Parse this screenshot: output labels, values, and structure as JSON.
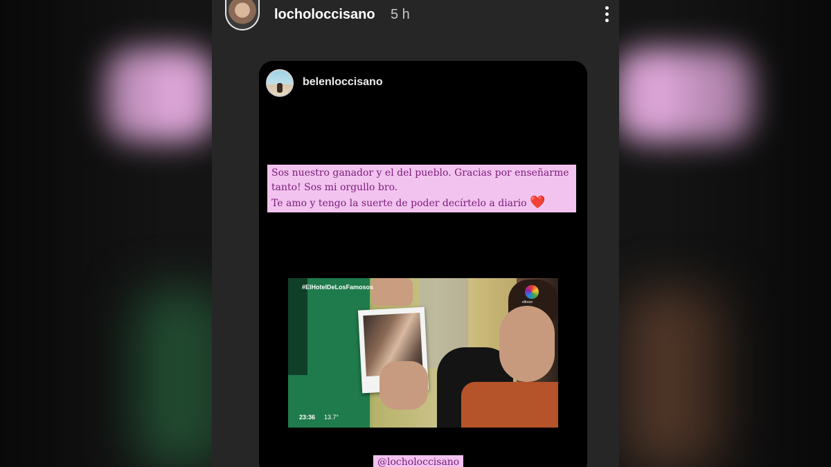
{
  "story": {
    "username": "locholoccisano",
    "time": "5 h"
  },
  "shared_post": {
    "username": "belenloccisano",
    "caption": {
      "line1": "Sos nuestro ganador y el del pueblo. Gracias por enseñarme",
      "line2": "tanto! Sos mi orgullo bro.",
      "line3": "Te amo y tengo la suerte de poder decírtelo a diario",
      "emoji": "❤️"
    },
    "tv": {
      "hashtag": "#ElHotelDeLosFamosos",
      "channel": "eltrece",
      "clock": "23:36",
      "temperature": "13.7°"
    },
    "mention": "@locholoccisano"
  },
  "icons": {
    "more": "more-vertical-icon",
    "heart": "heart-icon"
  }
}
